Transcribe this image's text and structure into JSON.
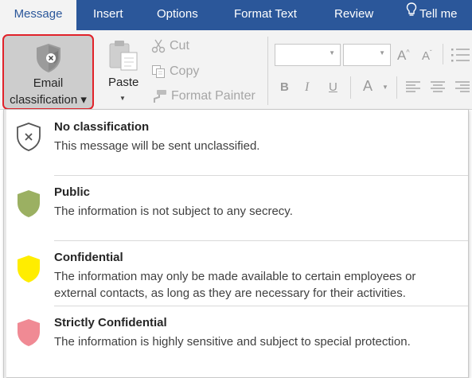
{
  "ribbon": {
    "tabs": [
      {
        "label": "Message",
        "active": true
      },
      {
        "label": "Insert"
      },
      {
        "label": "Options"
      },
      {
        "label": "Format Text"
      },
      {
        "label": "Review"
      },
      {
        "label": "Tell me",
        "icon": "lightbulb-icon"
      }
    ],
    "email_classification": {
      "line1": "Email",
      "line2": "classification ▾",
      "icon": "shield-x-icon"
    },
    "clipboard": {
      "paste_label": "Paste",
      "cut_label": "Cut",
      "copy_label": "Copy",
      "format_painter_label": "Format Painter"
    },
    "font_buttons": {
      "grow": "A",
      "shrink": "A",
      "bold": "B",
      "italic": "I",
      "underline": "U",
      "font_color": "A"
    }
  },
  "classification_menu": {
    "options": [
      {
        "title": "No classification",
        "description": "This message will be sent unclassified.",
        "color": "#ffffff",
        "icon": "shield-x-icon"
      },
      {
        "title": "Public",
        "description": "The information is not subject to any secrecy.",
        "color": "#9bb062",
        "icon": "shield-icon"
      },
      {
        "title": "Confidential",
        "description": "The information may only be made available to certain employees or external contacts, as long as they are necessary for their activities.",
        "color": "#ffed00",
        "icon": "shield-icon"
      },
      {
        "title": "Strictly Confidential",
        "description": "The information is highly sensitive and subject to special protection.",
        "color": "#f08a94",
        "icon": "shield-icon"
      }
    ]
  }
}
